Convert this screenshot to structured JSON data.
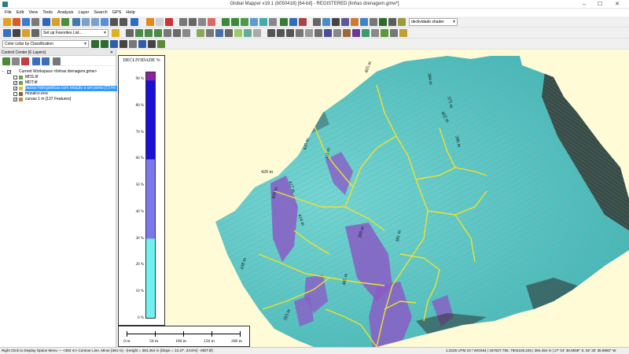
{
  "window": {
    "title": "Global Mapper v19.1 (b050418) [64-bit] - REGISTERED [linhas drenagem.gmw*]",
    "controls": [
      "–",
      "☐",
      "✕"
    ]
  },
  "menu": [
    "File",
    "Edit",
    "View",
    "Tools",
    "Analysis",
    "Layer",
    "Search",
    "GPS",
    "Help"
  ],
  "toolbar": {
    "shader_combo": "declividade shader",
    "favorites_combo": "Set up Favorites List...",
    "lidar_combo": "Color Lidar by Classification"
  },
  "control_center": {
    "header": "Control Center [6 Layers]",
    "close_glyph": "✕",
    "workspace": "Current Workspace <linhas drenagem.gmw>",
    "layers": [
      {
        "name": "MDS.tif",
        "checked": false,
        "selected": false
      },
      {
        "name": "MDT.tif",
        "checked": true,
        "selected": false
      },
      {
        "name": "bacias hidrográficas com relação a um ponto [73 Fe",
        "checked": true,
        "selected": true
      },
      {
        "name": "mosaico.ecw",
        "checked": false,
        "selected": false
      },
      {
        "name": "curvas 1 m [137 Features]",
        "checked": true,
        "selected": false
      }
    ]
  },
  "legend": {
    "title": "DECLIVIDADE %",
    "ticks": [
      "90 %",
      "80 %",
      "70 %",
      "60 %",
      "50 %",
      "40 %",
      "30 %",
      "20 %",
      "10 %",
      "0 %"
    ],
    "classes": [
      {
        "from": 0,
        "to": 30,
        "color": "#6ff1f1"
      },
      {
        "from": 30,
        "to": 60,
        "color": "#7a78ec"
      },
      {
        "from": 60,
        "to": 90,
        "color": "#1a10d6"
      },
      {
        "from": 90,
        "to": 93,
        "color": "#8e1ea6"
      }
    ]
  },
  "scalebar": {
    "labels": [
      "0 m",
      "50 m",
      "100 m",
      "150 m",
      "200 m"
    ]
  },
  "map_labels": [
    "405 m",
    "384 m",
    "420 m",
    "435 m",
    "411 m",
    "402 m",
    "414 m",
    "417 m",
    "399 m",
    "381 m",
    "375 m",
    "420 m",
    "438 m",
    "405 m",
    "393 m",
    "396 m"
  ],
  "status": {
    "left": "Right Click to Display Option Menu --- <384 m> Contour Line, Minor [384 m] - (Height = 384.454 m [Slope = 13.47', 23.8%] - MDT.tif)",
    "right": "1:2225   UTM 23 / WGS84 | 347827.786, 7604106.225 | 384.454 m | 27' 04' 36.5559'' S, 52' 32' 35.8960'' W"
  },
  "colors": {
    "map_background": "#fffbd6",
    "terrain": "#4fc3c6",
    "contours": "#c8864a",
    "drainage": "#f0e22a",
    "steep": "#8a5cc6",
    "selection": "#3399ff"
  }
}
